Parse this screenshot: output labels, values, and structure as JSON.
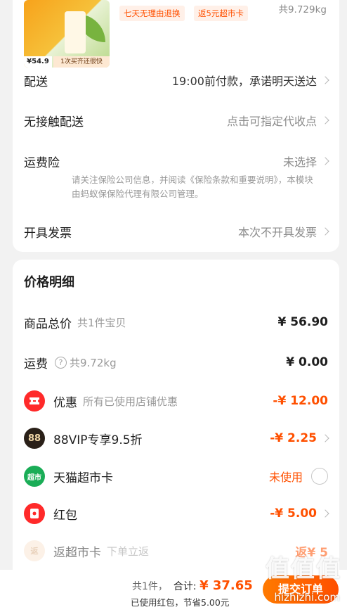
{
  "product": {
    "price_badge": "¥54.9",
    "promo_badge": "1次买齐还很快",
    "tags": [
      "七天无理由退换",
      "返5元超市卡"
    ],
    "weight": "共9.729kg"
  },
  "order": {
    "delivery": {
      "label": "配送",
      "value": "19:00前付款，承诺明天送达"
    },
    "contactless": {
      "label": "无接触配送",
      "value": "点击可指定代收点"
    },
    "shipping_insurance": {
      "label": "运费险",
      "value": "未选择",
      "note": "请关注保险公司信息，并阅读《保险条款和重要说明》，本模块由蚂蚁保保险代理有限公司管理。"
    },
    "invoice": {
      "label": "开具发票",
      "value": "本次不开具发票"
    }
  },
  "price_detail": {
    "title": "价格明细",
    "goods_total": {
      "label": "商品总价",
      "sub": "共1件宝贝",
      "amount": "¥ 56.90"
    },
    "shipping": {
      "label": "运费",
      "info_icon": "?",
      "sub": "共9.72kg",
      "amount": "¥ 0.00"
    },
    "discount": {
      "icon": "coupon-icon",
      "label": "优惠",
      "sub": "所有已使用店铺优惠",
      "amount": "-¥ 12.00"
    },
    "vip": {
      "icon_text": "88",
      "label": "88VIP专享9.5折",
      "amount": "-¥ 2.25"
    },
    "supermarket_card": {
      "icon_text": "超市",
      "label": "天猫超市卡",
      "status": "未使用"
    },
    "red_packet": {
      "icon": "red-packet-icon",
      "label": "红包",
      "amount": "-¥ 5.00"
    },
    "cashback": {
      "icon_text": "返",
      "label": "返超市卡",
      "sub": "下单立返",
      "amount": "返¥ 5"
    }
  },
  "footer": {
    "count": "共1件，",
    "total_label": "合计:",
    "total": "¥ 37.65",
    "note": "已使用红包，节省5.00元",
    "submit_label": "提交订单"
  },
  "watermark": {
    "text": "值值值",
    "site": "hizhizhi.com"
  },
  "colors": {
    "accent": "#ff5000",
    "background": "#f2f2f2",
    "card": "#ffffff"
  }
}
